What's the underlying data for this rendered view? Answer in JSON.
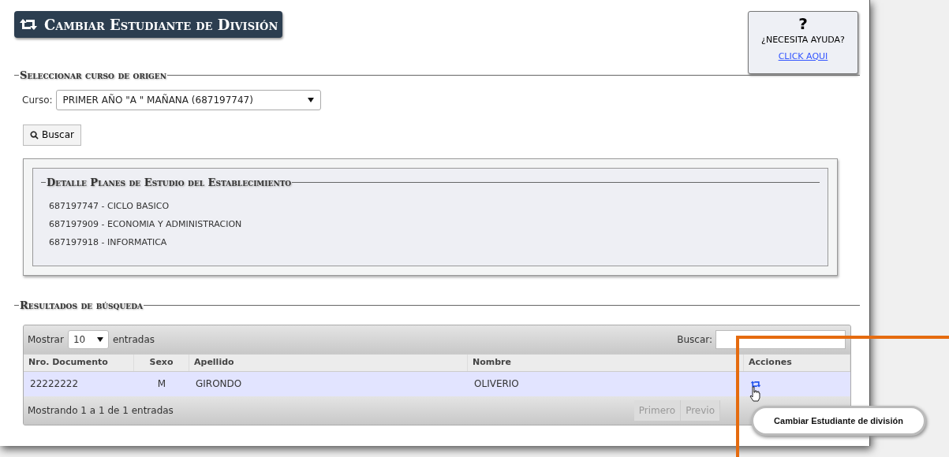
{
  "title": "Cambiar Estudiante de División",
  "help": {
    "icon": "?",
    "text": "¿NECESITA AYUDA?",
    "link": "CLICK AQUI"
  },
  "origin": {
    "legend": "Seleccionar curso de origen",
    "label": "Curso:",
    "value": "PRIMER AÑO \"A \" MAÑANA (687197747)",
    "button": "Buscar"
  },
  "plans": {
    "legend": "Detalle Planes de Estudio del Establecimiento",
    "items": [
      "687197747 - CICLO BASICO",
      "687197909 - ECONOMIA Y ADMINISTRACION",
      "687197918 - INFORMATICA"
    ]
  },
  "results": {
    "legend": "Resultados de búsqueda",
    "show_label": "Mostrar",
    "show_value": "10",
    "show_suffix": "entradas",
    "search_label": "Buscar:",
    "columns": [
      "Nro. Documento",
      "Sexo",
      "Apellido",
      "Nombre",
      "Acciones"
    ],
    "rows": [
      {
        "cells": [
          "22222222",
          "M",
          "GIRONDO",
          "OLIVERIO"
        ],
        "selected": true
      }
    ],
    "info": "Mostrando 1 a 1 de 1 entradas",
    "pager": [
      "Primero",
      "Previo"
    ]
  },
  "tooltip": "Cambiar Estudiante de división"
}
